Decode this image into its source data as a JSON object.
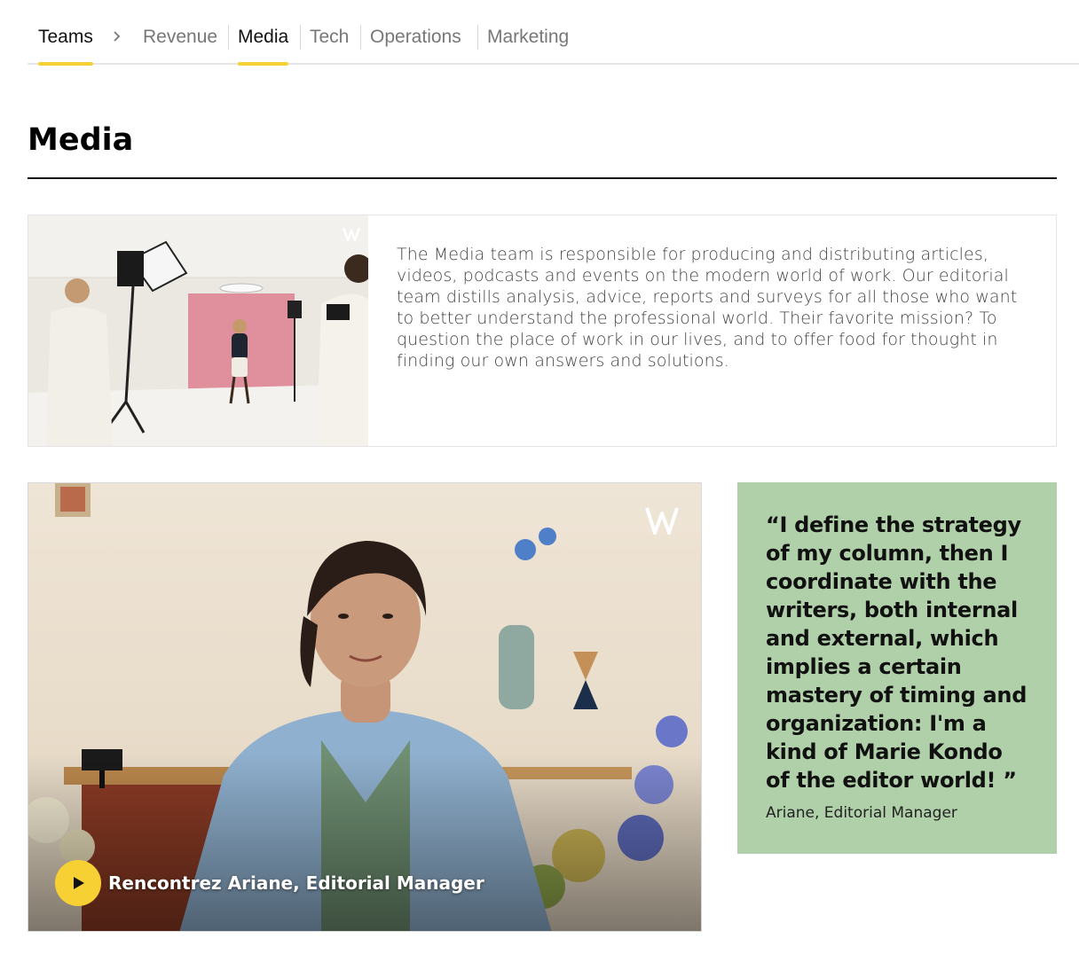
{
  "nav": {
    "root_label": "Teams",
    "tabs": [
      {
        "label": "Revenue",
        "active": false
      },
      {
        "label": "Media",
        "active": true
      },
      {
        "label": "Tech",
        "active": false
      },
      {
        "label": "Operations",
        "active": false
      },
      {
        "label": "Marketing",
        "active": false
      }
    ],
    "separator_icon": "chevron-right-icon"
  },
  "page": {
    "title": "Media"
  },
  "intro": {
    "photo": "studio-photo",
    "logo": "wttj-logo-icon",
    "text": "The Media team is responsible for producing and distributing articles, videos, podcasts and events on the modern world of work. Our editorial team distills analysis, advice, reports and surveys for all those who want to better understand the professional world. Their favorite mission? To question the place of work in our lives, and to offer food for thought in finding our own answers and solutions."
  },
  "video": {
    "title": "Rencontrez Ariane, Editorial Manager",
    "play_icon": "play-icon",
    "logo": "wttj-logo-icon"
  },
  "quote": {
    "text": "“I define the strategy of my column, then I coordinate with the writers, both internal and external, which implies a certain mastery of timing and organization: I'm a kind of Marie Kondo of the editor world! ”",
    "author": "Ariane, Editorial Manager"
  },
  "colors": {
    "accent": "#f7d134",
    "quote_bg": "#b0d0a9",
    "studio_pink": "#e0909c"
  }
}
